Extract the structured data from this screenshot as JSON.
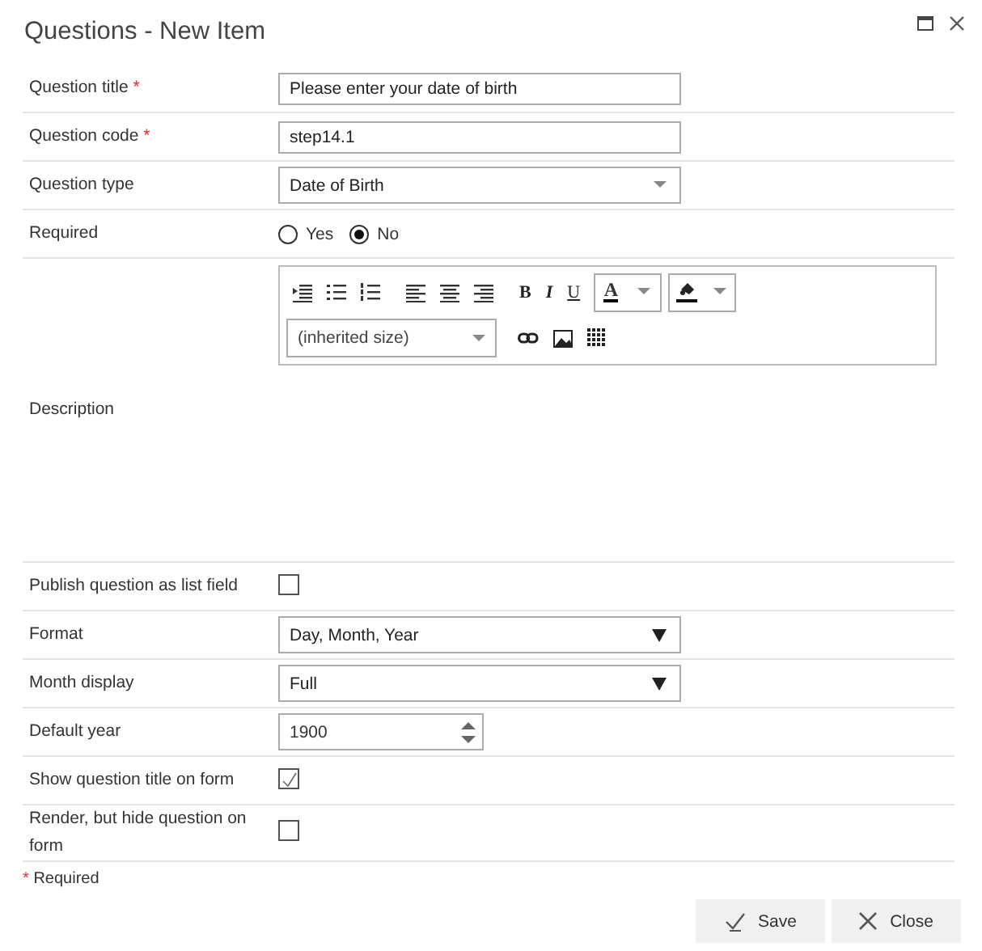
{
  "window": {
    "title": "Questions - New Item"
  },
  "rows": [
    {
      "kind": "text",
      "label": "Question title",
      "mark": "*",
      "value": "Please enter your date of birth"
    },
    {
      "kind": "text",
      "label": "Question code",
      "mark": "*",
      "value": "step14.1"
    },
    {
      "kind": "combo",
      "label": "Question type",
      "value": "Date of Birth"
    },
    {
      "kind": "radio",
      "label": "Required",
      "options": [
        {
          "label": "Yes",
          "selected": false
        },
        {
          "label": "No",
          "selected": true
        }
      ]
    },
    {
      "kind": "editor",
      "label": "Description",
      "format_buttons": [
        "B",
        "I",
        "U"
      ],
      "color_button": "A",
      "font_size": "(inherited size)"
    },
    {
      "kind": "checkbox",
      "label": "Publish question as list field",
      "checked": false
    },
    {
      "kind": "select",
      "label": "Format",
      "value": "Day, Month, Year"
    },
    {
      "kind": "select",
      "label": "Month display",
      "value": "Full"
    },
    {
      "kind": "number",
      "label": "Default year",
      "value": "1900"
    },
    {
      "kind": "checkbox",
      "label": "Show question title on form",
      "checked": true
    },
    {
      "kind": "checkbox",
      "label": "Render, but hide question on form",
      "checked": false
    }
  ],
  "required_note": {
    "mark": "*",
    "text": "Required"
  },
  "buttons": [
    {
      "kind": "save",
      "label": "Save"
    },
    {
      "kind": "close",
      "label": "Close"
    }
  ]
}
